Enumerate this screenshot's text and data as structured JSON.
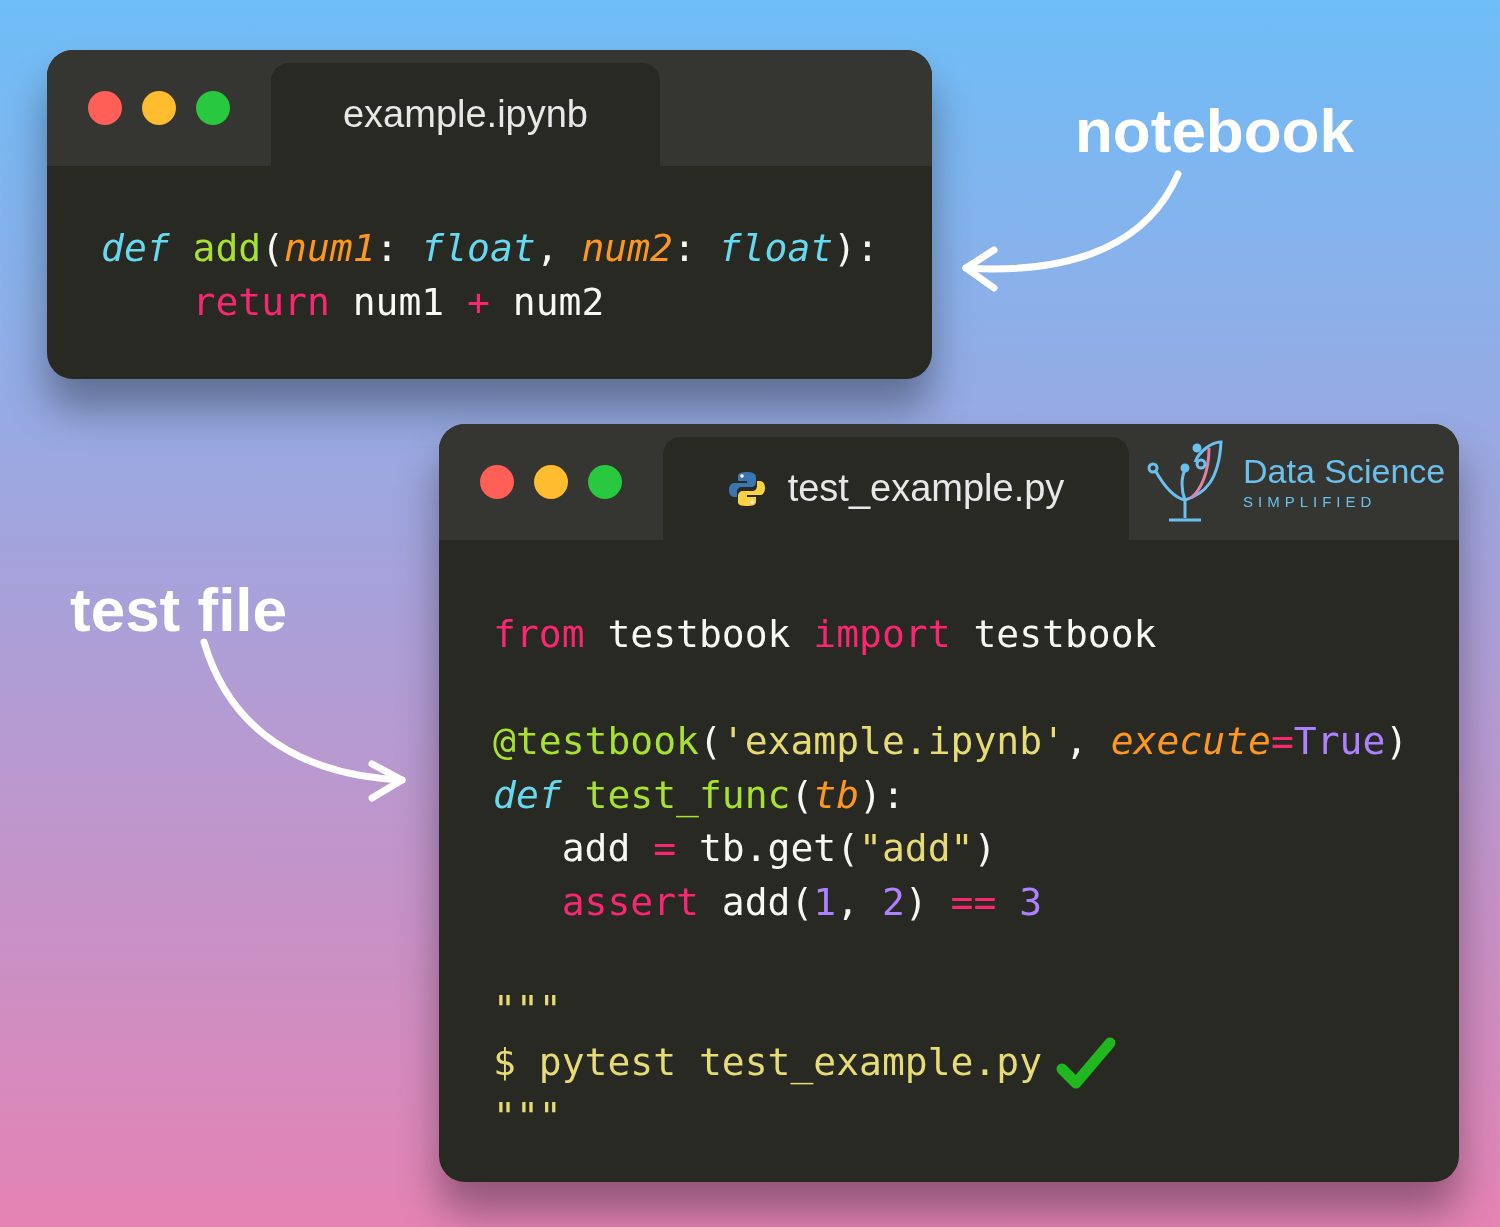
{
  "labels": [
    {
      "text": "notebook"
    },
    {
      "text": "test file"
    }
  ],
  "windows": [
    {
      "tab": {
        "title": "example.ipynb",
        "python_icon": false
      },
      "lines": [
        {
          "kind": "code",
          "tokens": [
            {
              "kind": "storage",
              "text": "def "
            },
            {
              "kind": "func",
              "text": "add"
            },
            {
              "kind": "plain",
              "text": "("
            },
            {
              "kind": "param",
              "text": "num1"
            },
            {
              "kind": "plain",
              "text": ": "
            },
            {
              "kind": "storage",
              "text": "float"
            },
            {
              "kind": "plain",
              "text": ", "
            },
            {
              "kind": "param",
              "text": "num2"
            },
            {
              "kind": "plain",
              "text": ": "
            },
            {
              "kind": "storage",
              "text": "float"
            },
            {
              "kind": "plain",
              "text": "):"
            }
          ]
        },
        {
          "kind": "code",
          "tokens": [
            {
              "kind": "keyword",
              "text": "    return"
            },
            {
              "kind": "plain",
              "text": " num1 "
            },
            {
              "kind": "keyword",
              "text": "+"
            },
            {
              "kind": "plain",
              "text": " num2"
            }
          ]
        }
      ]
    },
    {
      "tab": {
        "title": "test_example.py",
        "python_icon": true
      },
      "logo": {
        "title": "Data Science",
        "subtitle": "SIMPLIFIED"
      },
      "lines": [
        {
          "kind": "code",
          "tokens": [
            {
              "kind": "keyword",
              "text": "from"
            },
            {
              "kind": "plain",
              "text": " testbook "
            },
            {
              "kind": "keyword",
              "text": "import"
            },
            {
              "kind": "plain",
              "text": " testbook"
            }
          ]
        },
        {
          "kind": "blank"
        },
        {
          "kind": "code",
          "tokens": [
            {
              "kind": "func",
              "text": "@testbook"
            },
            {
              "kind": "plain",
              "text": "("
            },
            {
              "kind": "string",
              "text": "'example.ipynb'"
            },
            {
              "kind": "plain",
              "text": ", "
            },
            {
              "kind": "param",
              "text": "execute"
            },
            {
              "kind": "keyword",
              "text": "="
            },
            {
              "kind": "constant",
              "text": "True"
            },
            {
              "kind": "plain",
              "text": ")"
            }
          ]
        },
        {
          "kind": "code",
          "tokens": [
            {
              "kind": "storage",
              "text": "def "
            },
            {
              "kind": "func",
              "text": "test_func"
            },
            {
              "kind": "plain",
              "text": "("
            },
            {
              "kind": "param",
              "text": "tb"
            },
            {
              "kind": "plain",
              "text": "):"
            }
          ]
        },
        {
          "kind": "code",
          "tokens": [
            {
              "kind": "plain",
              "text": "   add "
            },
            {
              "kind": "keyword",
              "text": "="
            },
            {
              "kind": "plain",
              "text": " tb.get("
            },
            {
              "kind": "string",
              "text": "\"add\""
            },
            {
              "kind": "plain",
              "text": ")"
            }
          ]
        },
        {
          "kind": "code",
          "tokens": [
            {
              "kind": "keyword",
              "text": "   assert"
            },
            {
              "kind": "plain",
              "text": " add("
            },
            {
              "kind": "constant",
              "text": "1"
            },
            {
              "kind": "plain",
              "text": ", "
            },
            {
              "kind": "constant",
              "text": "2"
            },
            {
              "kind": "plain",
              "text": ") "
            },
            {
              "kind": "keyword",
              "text": "== "
            },
            {
              "kind": "constant",
              "text": "3"
            }
          ]
        },
        {
          "kind": "blank"
        },
        {
          "kind": "code",
          "tokens": [
            {
              "kind": "string",
              "text": "\"\"\""
            }
          ]
        },
        {
          "kind": "code",
          "passed": true,
          "tokens": [
            {
              "kind": "string",
              "text": "$ pytest test_example.py"
            }
          ]
        },
        {
          "kind": "code",
          "tokens": [
            {
              "kind": "string",
              "text": "\"\"\""
            }
          ]
        }
      ]
    }
  ]
}
